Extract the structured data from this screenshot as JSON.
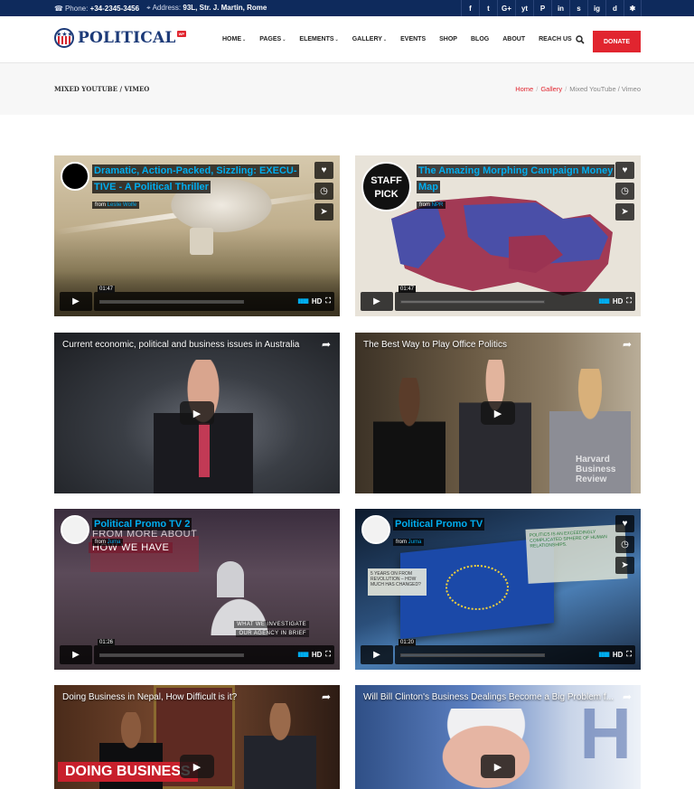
{
  "topbar": {
    "phone_label": "Phone:",
    "phone": "+34-2345-3456",
    "address_label": "Address:",
    "address": "93L, Str. J. Martin, Rome",
    "socials": [
      "f",
      "t",
      "G+",
      "yt",
      "P",
      "in",
      "s",
      "ig",
      "d",
      "✱"
    ]
  },
  "header": {
    "logo_text": "POLITICAL",
    "logo_badge": "WP",
    "nav": [
      "HOME",
      "PAGES",
      "ELEMENTS",
      "GALLERY",
      "EVENTS",
      "SHOP",
      "BLOG",
      "ABOUT",
      "REACH US"
    ],
    "nav_dropdowns": [
      true,
      true,
      true,
      true,
      false,
      false,
      false,
      false,
      false
    ],
    "donate_label": "DONATE"
  },
  "page": {
    "title": "MIXED YOUTUBE / VIMEO",
    "breadcrumbs": [
      "Home",
      "Gallery",
      "Mixed YouTube / Vimeo"
    ]
  },
  "videos": [
    {
      "source": "vimeo",
      "title": "Dramatic, Action-Packed, Sizzling: EXECU-TIVE - A Political Thriller",
      "from": "from",
      "author": "Leslie Wolfe",
      "time": "01:47"
    },
    {
      "source": "vimeo",
      "title": "The Amazing Morphing Campaign Money Map",
      "from": "from",
      "author": "NPR",
      "time": "01:47",
      "badge": "STAFF PICK"
    },
    {
      "source": "youtube",
      "title": "Current economic, political and business issues in Australia"
    },
    {
      "source": "youtube",
      "title": "The Best Way to Play Office Politics",
      "watermark": "Harvard Business Review"
    },
    {
      "source": "vimeo",
      "title": "Political Promo TV 2",
      "from": "from",
      "author": "Juma",
      "time": "01:26",
      "overlay": [
        "FROM MORE ABOUT",
        "HOW WE HAVE",
        "WHAT WE INVESTIGATE",
        "OUR AGENCY IN BRIEF"
      ]
    },
    {
      "source": "vimeo",
      "title": "Political Promo TV",
      "from": "from",
      "author": "Juma",
      "time": "01:20",
      "overlay": [
        "POLITICS IS AN EXCEEDINGLY COMPLICATED SPHERE OF HUMAN RELATIONSHIPS.",
        "5 YEARS ON FROM REVOLUTION – HOW MUCH HAS CHANGED?"
      ]
    },
    {
      "source": "youtube",
      "title": "Doing Business in Nepal, How Difficult is it?",
      "lower_third": "DOING BUSINESS"
    },
    {
      "source": "youtube",
      "title": "Will Bill Clinton's Business Dealings Become a Big Problem f..."
    }
  ],
  "vimeo_ui": {
    "hd": "HD",
    "logo": "vimeo"
  },
  "icons": {
    "heart": "heart-icon",
    "clock": "clock-icon",
    "send": "send-icon",
    "play": "play-icon",
    "share": "share-icon",
    "fullscreen": "fullscreen-icon"
  },
  "colors": {
    "topbar": "#0e2a5c",
    "accent": "#e1252f",
    "vimeo_blue": "#00adef",
    "brand": "#1c3a78"
  }
}
